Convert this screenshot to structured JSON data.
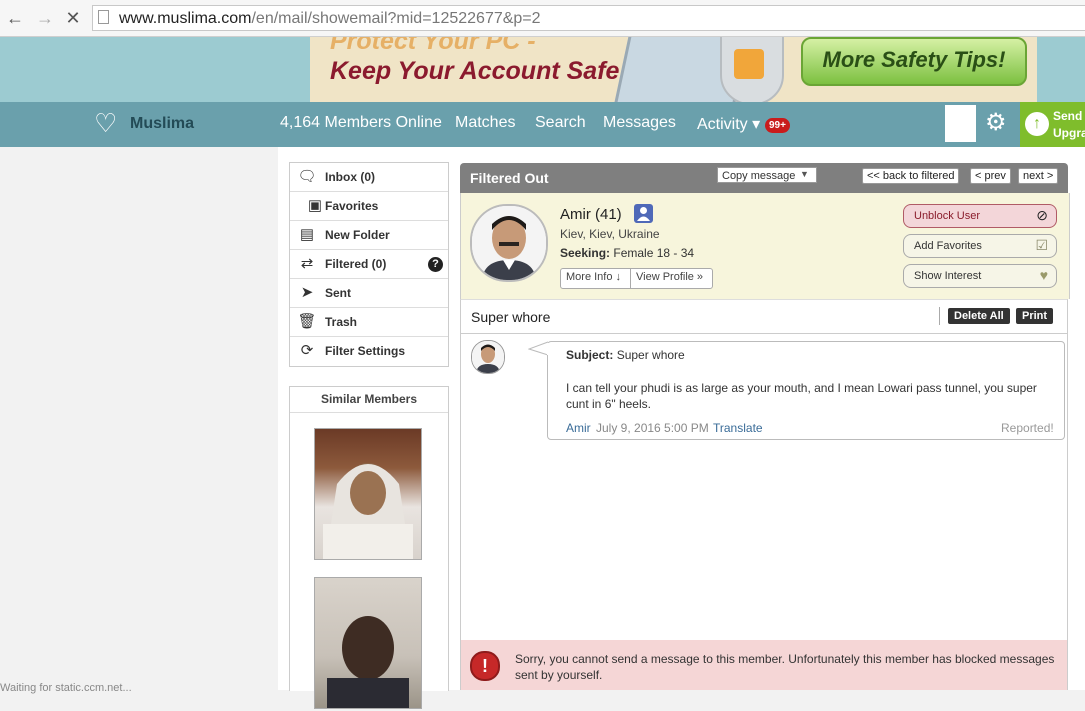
{
  "browser": {
    "url_host": "www.muslima.com",
    "url_path": "/en/mail/showemail?mid=12522677&p=2"
  },
  "banner": {
    "line1": "Protect Your PC -",
    "line2": "Keep Your Account Safe!",
    "safety_button": "More Safety Tips!"
  },
  "nav": {
    "logo": "Muslima",
    "members_online": "4,164 Members Online",
    "matches": "Matches",
    "search": "Search",
    "messages": "Messages",
    "activity": "Activity ▾",
    "activity_badge": "99+",
    "send_line1": "Send",
    "send_line2": "Upgra"
  },
  "sidebar": {
    "items": [
      {
        "label": "Inbox (0)",
        "icon": "speech-bubble-icon"
      },
      {
        "label": "Favorites",
        "icon": "folder-check-icon"
      },
      {
        "label": "New Folder",
        "icon": "folder-plus-icon"
      },
      {
        "label": "Filtered (0)",
        "icon": "shuffle-icon"
      },
      {
        "label": "Sent",
        "icon": "paper-plane-icon"
      },
      {
        "label": "Trash",
        "icon": "trash-icon"
      },
      {
        "label": "Filter Settings",
        "icon": "refresh-icon"
      }
    ],
    "help": "?",
    "similar_title": "Similar Members"
  },
  "panel": {
    "title": "Filtered Out",
    "copy_message": "Copy message",
    "back": "<< back to filtered",
    "prev": "< prev",
    "next": "next >"
  },
  "profile": {
    "name": "Amir (41)",
    "location": "Kiev, Kiev, Ukraine",
    "seeking_label": "Seeking:",
    "seeking_value": "Female 18 - 34",
    "more_info": "More Info ↓",
    "view_profile": "View Profile »",
    "unblock": "Unblock User",
    "add_favorites": "Add Favorites",
    "show_interest": "Show Interest"
  },
  "thread": {
    "subject_title": "Super whore",
    "delete_all": "Delete All",
    "print": "Print"
  },
  "message": {
    "subject_label": "Subject:",
    "subject_value": "Super whore",
    "body": "I can tell your phudi is as large as your mouth, and I mean Lowari pass tunnel, you super cunt in 6\" heels.",
    "sender": "Amir",
    "date": "July 9, 2016 5:00 PM",
    "translate": "Translate",
    "reported": "Reported!"
  },
  "blocked": {
    "icon": "!",
    "text": "Sorry, you cannot send a message to this member. Unfortunately this member has blocked messages sent by yourself."
  },
  "status_text": "Waiting for static.ccm.net..."
}
